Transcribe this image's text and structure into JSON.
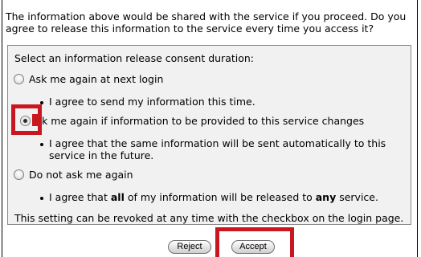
{
  "intro_text": "The information above would be shared with the service if you proceed. Do you agree to release this information to the service every time you access it?",
  "consent": {
    "heading": "Select an information release consent duration:",
    "options": [
      {
        "label": "Ask me again at next login",
        "detail": "I agree to send my information this time.",
        "selected": false
      },
      {
        "label_hidden_prefix": "A",
        "label": "k me again if information to be provided to this service changes",
        "detail": "I agree that the same information will be sent automatically to this service in the future.",
        "selected": true
      },
      {
        "label": "Do not ask me again",
        "detail_pre": "I agree that ",
        "detail_bold1": "all",
        "detail_mid": " of my information will be released to ",
        "detail_bold2": "any",
        "detail_post": " service.",
        "selected": false
      }
    ],
    "footer_note": "This setting can be revoked at any time with the checkbox on the login page."
  },
  "buttons": {
    "reject": "Reject",
    "accept": "Accept"
  },
  "colors": {
    "highlight": "#c8171e",
    "panel_bg": "#f1f1f1",
    "panel_border": "#8a8a8a"
  }
}
